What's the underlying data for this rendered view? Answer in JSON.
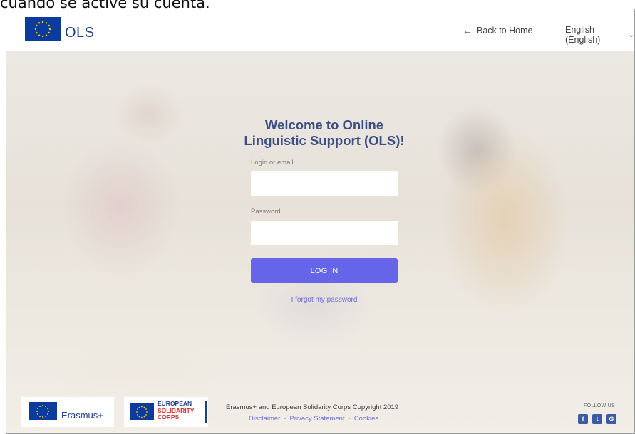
{
  "caption": "cuando se active su cuenta.",
  "header": {
    "logo_text": "OLS",
    "back_home": "Back to Home",
    "back_arrow": "←",
    "language": "English (English)",
    "language_chevron": "⌄"
  },
  "login": {
    "title": "Welcome to Online Linguistic Support (OLS)!",
    "login_label": "Login or email",
    "login_value": "",
    "password_label": "Password",
    "password_value": "",
    "button": "LOG IN",
    "forgot": "I forgot my password"
  },
  "footer": {
    "erasmus": "Erasmus+",
    "esc_line1": "EUROPEAN",
    "esc_line2": "SOLIDARITY",
    "esc_line3": "CORPS",
    "copyright": "Erasmus+ and European Solidarity Corps Copyright 2019",
    "links": [
      "Disclaimer",
      "Privacy Statement",
      "Cookies"
    ],
    "link_separator": "-",
    "follow_us": "FOLLOW US",
    "social": {
      "facebook": "f",
      "twitter": "t",
      "google": "G"
    }
  },
  "colors": {
    "brand_blue": "#1d3f8f",
    "eu_flag_blue": "#0b3b9c",
    "eu_star_yellow": "#ffcc00",
    "login_button": "#6665ea",
    "link": "#6f6cdc",
    "title": "#3c4e83"
  }
}
